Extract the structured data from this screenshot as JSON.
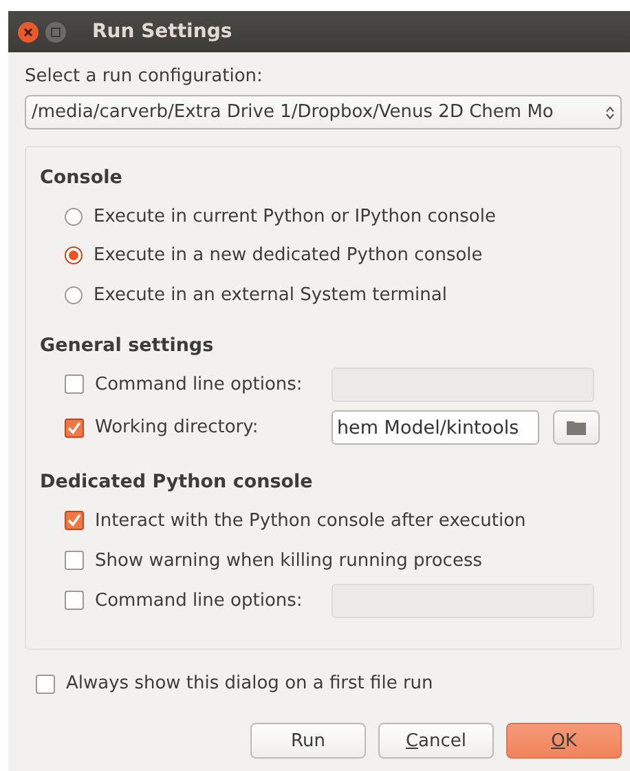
{
  "window": {
    "title": "Run Settings"
  },
  "configuration": {
    "label": "Select a run configuration:",
    "value": "/media/carverb/Extra Drive 1/Dropbox/Venus 2D Chem Mo"
  },
  "console": {
    "title": "Console",
    "options": [
      {
        "label": "Execute in current Python or IPython console",
        "selected": false
      },
      {
        "label": "Execute in a new dedicated Python console",
        "selected": true
      },
      {
        "label": "Execute in an external System terminal",
        "selected": false
      }
    ]
  },
  "general_settings": {
    "title": "General settings",
    "rows": [
      {
        "kind": "field",
        "label": "Command line options:",
        "checked": false
      },
      {
        "kind": "directory",
        "label": "Working directory:",
        "checked": true,
        "value": "hem Model/kintools"
      }
    ]
  },
  "dedicated_console": {
    "title": "Dedicated Python console",
    "rows": [
      {
        "kind": "plain",
        "label": "Interact with the Python console after execution",
        "checked": true
      },
      {
        "kind": "plain",
        "label": "Show warning when killing running process",
        "checked": false
      },
      {
        "kind": "field",
        "label": "Command line options:",
        "checked": false
      }
    ]
  },
  "always_show": {
    "label": "Always show this dialog on a first file run",
    "checked": false
  },
  "buttons": [
    {
      "label": "Run",
      "kind": "normal",
      "mnemonic": false
    },
    {
      "label": "Cancel",
      "kind": "normal",
      "mnemonic": true
    },
    {
      "label": "OK",
      "kind": "default",
      "mnemonic": true
    }
  ]
}
